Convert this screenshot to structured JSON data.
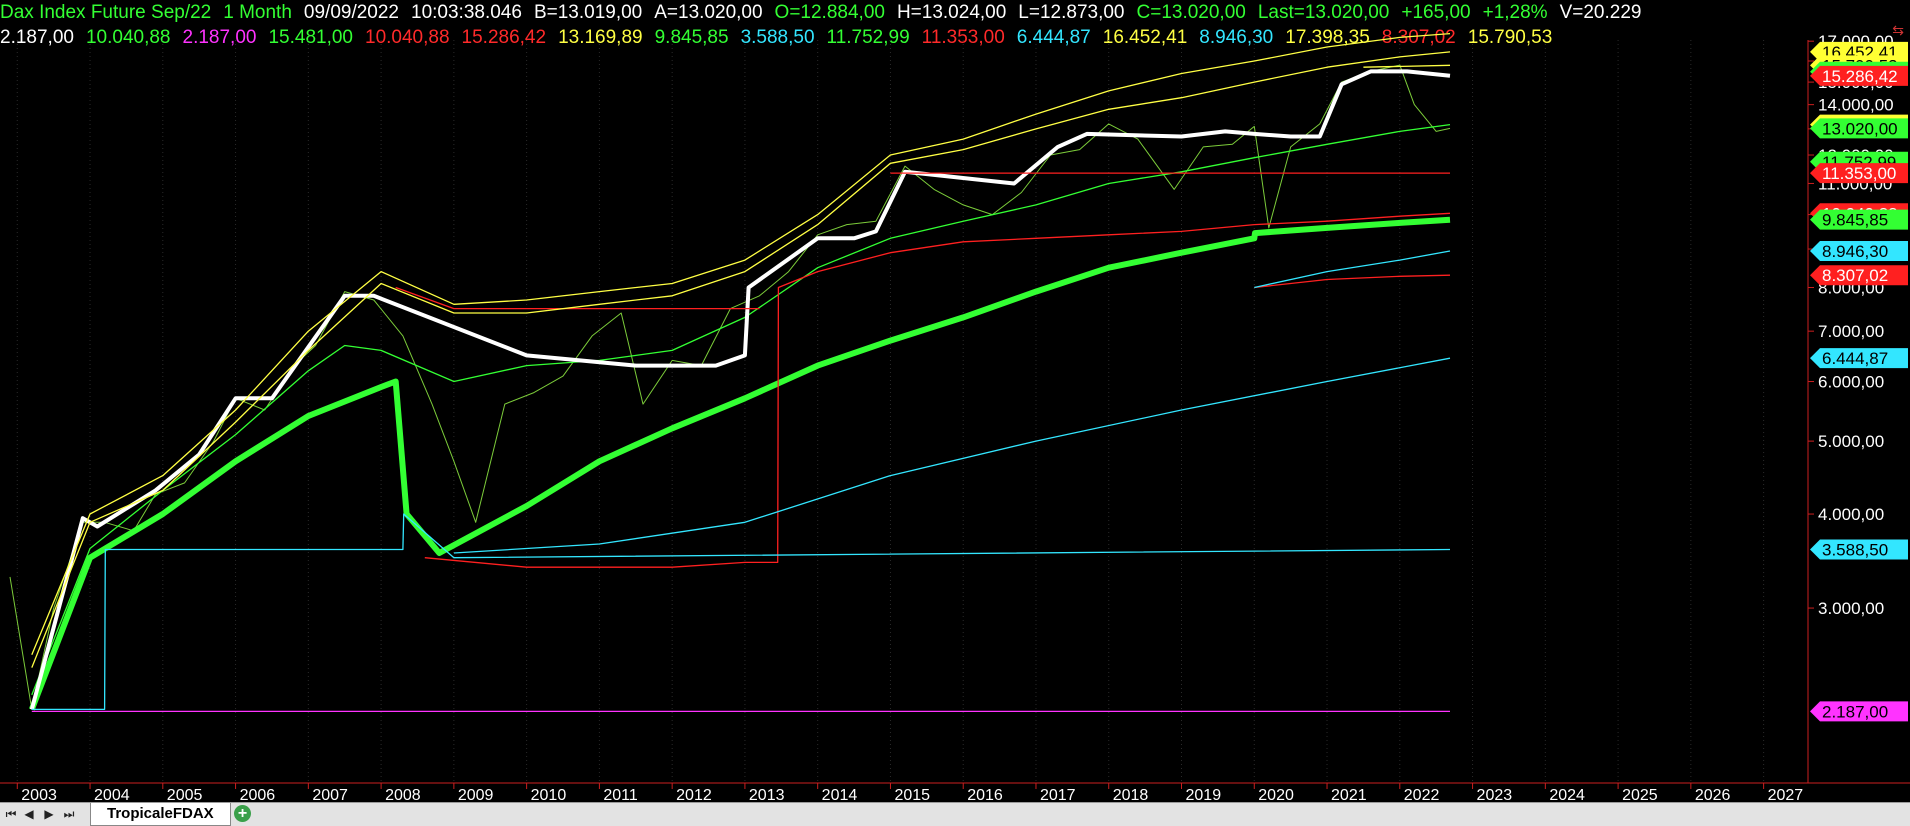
{
  "header": {
    "symbol": "Dax Index Future Sep/22",
    "period": "1 Month",
    "date": "09/09/2022",
    "time": "10:03:38.046",
    "bid": "B=13.019,00",
    "ask": "A=13.020,00",
    "open": "O=12.884,00",
    "high": "H=13.024,00",
    "low": "L=12.873,00",
    "close": "C=13.020,00",
    "last": "Last=13.020,00",
    "change": "+165,00",
    "change_pct": "+1,28%",
    "volume": "V=20.229"
  },
  "indicator_values": [
    {
      "text": "2.187,00",
      "color": "#ffffff"
    },
    {
      "text": "10.040,88",
      "color": "#33ff33"
    },
    {
      "text": "2.187,00",
      "color": "#ff33ff"
    },
    {
      "text": "15.481,00",
      "color": "#33ff33"
    },
    {
      "text": "10.040,88",
      "color": "#ff2a2a"
    },
    {
      "text": "15.286,42",
      "color": "#ff2a2a"
    },
    {
      "text": "13.169,89",
      "color": "#ffff44"
    },
    {
      "text": "9.845,85",
      "color": "#33ff33"
    },
    {
      "text": "3.588,50",
      "color": "#33e6ff"
    },
    {
      "text": "11.752,99",
      "color": "#33ff33"
    },
    {
      "text": "11.353,00",
      "color": "#ff2a2a"
    },
    {
      "text": "6.444,87",
      "color": "#33e6ff"
    },
    {
      "text": "16.452,41",
      "color": "#ffff44"
    },
    {
      "text": "8.946,30",
      "color": "#33e6ff"
    },
    {
      "text": "17.398,35",
      "color": "#ffff44"
    },
    {
      "text": "8.307,02",
      "color": "#ff2a2a"
    },
    {
      "text": "15.790,53",
      "color": "#ffff44"
    }
  ],
  "price_tags": [
    {
      "text": "16.452,41",
      "value": 16452,
      "bg": "#ffff33",
      "fg": "#000000"
    },
    {
      "text": "15.790,53",
      "value": 15790,
      "bg": "#ffff33",
      "fg": "#000000"
    },
    {
      "text": "15.481,00",
      "value": 15481,
      "bg": "#33ff33",
      "fg": "#000000"
    },
    {
      "text": "15.286,42",
      "value": 15286,
      "bg": "#ff2020",
      "fg": "#ffffff"
    },
    {
      "text": "13.169,89",
      "value": 13170,
      "bg": "#ffff33",
      "fg": "#000000"
    },
    {
      "text": "13.020,00",
      "value": 13020,
      "bg": "#33ff33",
      "fg": "#000000"
    },
    {
      "text": "11.752,99",
      "value": 11753,
      "bg": "#33ff33",
      "fg": "#000000"
    },
    {
      "text": "11.353,00",
      "value": 11353,
      "bg": "#ff2020",
      "fg": "#ffffff"
    },
    {
      "text": "10.040,88",
      "value": 10041,
      "bg": "#ff2020",
      "fg": "#ffffff"
    },
    {
      "text": "9.845,85",
      "value": 9846,
      "bg": "#33ff33",
      "fg": "#000000"
    },
    {
      "text": "8.946,30",
      "value": 8946,
      "bg": "#33e6ff",
      "fg": "#000000"
    },
    {
      "text": "8.307,02",
      "value": 8307,
      "bg": "#ff2020",
      "fg": "#ffffff"
    },
    {
      "text": "6.444,87",
      "value": 6445,
      "bg": "#33e6ff",
      "fg": "#000000"
    },
    {
      "text": "3.588,50",
      "value": 3589,
      "bg": "#33e6ff",
      "fg": "#000000"
    },
    {
      "text": "2.187,00",
      "value": 2187,
      "bg": "#ff33ff",
      "fg": "#000000"
    }
  ],
  "statusbar": {
    "sheet_tab": "TropicaleFDAX",
    "add_tab_icon": "plus-icon"
  },
  "chart_data": {
    "type": "line",
    "title": "Dax Index Future Sep/22",
    "xlabel": "",
    "ylabel": "",
    "x_tick_labels": [
      "2003",
      "2004",
      "2005",
      "2006",
      "2007",
      "2008",
      "2009",
      "2010",
      "2011",
      "2012",
      "2013",
      "2014",
      "2015",
      "2016",
      "2017",
      "2018",
      "2019",
      "2020",
      "2021",
      "2022",
      "2023",
      "2024",
      "2025",
      "2026",
      "2027"
    ],
    "y_tick_labels": [
      "17.000,00",
      "16.000,00",
      "15.000,00",
      "14.000,00",
      "13.000,00",
      "12.000,00",
      "11.000,00",
      "10.000,00",
      "9.000,00",
      "8.000,00",
      "7.000,00",
      "6.000,00",
      "5.000,00",
      "4.000,00",
      "3.000,00"
    ],
    "y_tick_values": [
      17000,
      16000,
      15000,
      14000,
      13000,
      12000,
      11000,
      10000,
      9000,
      8000,
      7000,
      6000,
      5000,
      4000,
      3000
    ],
    "xlim": [
      2002.9,
      2027.5
    ],
    "ylim": [
      1800,
      17700
    ],
    "log_scale": true,
    "grid": "vertical dotted",
    "series": [
      {
        "color": "#7ccc3a",
        "points": [
          [
            2002.9,
            3300
          ],
          [
            2003.2,
            2200
          ],
          [
            2003.5,
            3000
          ],
          [
            2003.9,
            3900
          ],
          [
            2004.2,
            3900
          ],
          [
            2004.6,
            3800
          ],
          [
            2004.9,
            4250
          ],
          [
            2005.3,
            4400
          ],
          [
            2005.7,
            5000
          ],
          [
            2006.0,
            5700
          ],
          [
            2006.4,
            5500
          ],
          [
            2006.8,
            6300
          ],
          [
            2007.1,
            6700
          ],
          [
            2007.5,
            7900
          ],
          [
            2007.9,
            7700
          ],
          [
            2008.3,
            6900
          ],
          [
            2008.7,
            5600
          ],
          [
            2009.0,
            4700
          ],
          [
            2009.3,
            3900
          ],
          [
            2009.7,
            5600
          ],
          [
            2010.1,
            5800
          ],
          [
            2010.5,
            6100
          ],
          [
            2010.9,
            6900
          ],
          [
            2011.3,
            7400
          ],
          [
            2011.6,
            5600
          ],
          [
            2012.0,
            6400
          ],
          [
            2012.4,
            6300
          ],
          [
            2012.8,
            7500
          ],
          [
            2013.2,
            7800
          ],
          [
            2013.6,
            8400
          ],
          [
            2014.0,
            9400
          ],
          [
            2014.4,
            9700
          ],
          [
            2014.8,
            9800
          ],
          [
            2015.2,
            11600
          ],
          [
            2015.6,
            10800
          ],
          [
            2016.0,
            10300
          ],
          [
            2016.4,
            10000
          ],
          [
            2016.8,
            10700
          ],
          [
            2017.2,
            12000
          ],
          [
            2017.6,
            12200
          ],
          [
            2018.0,
            13200
          ],
          [
            2018.4,
            12600
          ],
          [
            2018.9,
            10800
          ],
          [
            2019.3,
            12300
          ],
          [
            2019.7,
            12400
          ],
          [
            2020.0,
            13100
          ],
          [
            2020.2,
            9600
          ],
          [
            2020.5,
            12300
          ],
          [
            2020.9,
            13200
          ],
          [
            2021.2,
            15000
          ],
          [
            2021.6,
            15500
          ],
          [
            2022.0,
            15800
          ],
          [
            2022.2,
            14000
          ],
          [
            2022.5,
            12900
          ],
          [
            2022.69,
            13020
          ]
        ]
      },
      {
        "color": "#33ff33",
        "points": [
          [
            2003.2,
            2200
          ],
          [
            2004.0,
            3500
          ],
          [
            2005.0,
            4000
          ],
          [
            2006.0,
            4700
          ],
          [
            2007.0,
            5400
          ],
          [
            2008.0,
            5900
          ],
          [
            2008.2,
            6000
          ],
          [
            2008.35,
            4000
          ],
          [
            2008.8,
            3550
          ],
          [
            2010.0,
            4100
          ],
          [
            2011.0,
            4700
          ],
          [
            2012.0,
            5200
          ],
          [
            2013.0,
            5700
          ],
          [
            2014.0,
            6300
          ],
          [
            2015.0,
            6800
          ],
          [
            2016.0,
            7300
          ],
          [
            2017.0,
            7900
          ],
          [
            2018.0,
            8500
          ],
          [
            2019.0,
            8900
          ],
          [
            2020.0,
            9300
          ],
          [
            2020.01,
            9450
          ],
          [
            2021.0,
            9600
          ],
          [
            2022.0,
            9750
          ],
          [
            2022.69,
            9845
          ]
        ]
      },
      {
        "color": "#33ff33",
        "points": [
          [
            2003.2,
            2300
          ],
          [
            2004.0,
            3600
          ],
          [
            2005.0,
            4300
          ],
          [
            2006.0,
            5100
          ],
          [
            2007.0,
            6200
          ],
          [
            2007.5,
            6700
          ],
          [
            2008.0,
            6600
          ],
          [
            2009.0,
            6000
          ],
          [
            2010.0,
            6300
          ],
          [
            2011.0,
            6400
          ],
          [
            2012.0,
            6600
          ],
          [
            2013.0,
            7300
          ],
          [
            2014.0,
            8500
          ],
          [
            2015.0,
            9300
          ],
          [
            2016.0,
            9800
          ],
          [
            2017.0,
            10300
          ],
          [
            2018.0,
            11000
          ],
          [
            2019.0,
            11400
          ],
          [
            2020.0,
            11900
          ],
          [
            2021.0,
            12400
          ],
          [
            2022.0,
            12900
          ],
          [
            2022.69,
            13170
          ]
        ]
      },
      {
        "color": "#ffffff",
        "points": [
          [
            2003.2,
            2200
          ],
          [
            2003.9,
            3950
          ],
          [
            2004.1,
            3850
          ],
          [
            2004.9,
            4300
          ],
          [
            2005.5,
            4800
          ],
          [
            2006.0,
            5700
          ],
          [
            2006.5,
            5700
          ],
          [
            2007.5,
            7800
          ],
          [
            2007.9,
            7800
          ],
          [
            2010.0,
            6500
          ],
          [
            2011.5,
            6300
          ],
          [
            2012.6,
            6300
          ],
          [
            2013.0,
            6500
          ],
          [
            2013.05,
            8000
          ],
          [
            2014.0,
            9300
          ],
          [
            2014.5,
            9300
          ],
          [
            2014.8,
            9500
          ],
          [
            2015.2,
            11400
          ],
          [
            2016.7,
            11000
          ],
          [
            2017.3,
            12300
          ],
          [
            2017.7,
            12800
          ],
          [
            2019.0,
            12700
          ],
          [
            2019.6,
            12900
          ],
          [
            2020.0,
            12800
          ],
          [
            2020.5,
            12700
          ],
          [
            2020.9,
            12700
          ],
          [
            2021.2,
            14900
          ],
          [
            2021.6,
            15500
          ],
          [
            2022.1,
            15500
          ],
          [
            2022.69,
            15290
          ]
        ]
      },
      {
        "color": "#ff2020",
        "points": [
          [
            2008.2,
            8000
          ],
          [
            2009.0,
            7500
          ],
          [
            2010.0,
            7500
          ],
          [
            2011.0,
            7500
          ],
          [
            2012.0,
            7500
          ],
          [
            2013.0,
            7500
          ],
          [
            2013.2,
            7500
          ]
        ]
      },
      {
        "color": "#ff2020",
        "points": [
          [
            2008.6,
            3500
          ],
          [
            2010.0,
            3400
          ],
          [
            2011.0,
            3400
          ],
          [
            2012.0,
            3400
          ],
          [
            2013.0,
            3450
          ],
          [
            2013.45,
            3450
          ],
          [
            2013.46,
            8000
          ],
          [
            2014.0,
            8400
          ],
          [
            2015.0,
            8900
          ],
          [
            2016.0,
            9200
          ],
          [
            2017.0,
            9300
          ],
          [
            2018.0,
            9400
          ],
          [
            2019.0,
            9500
          ],
          [
            2020.0,
            9700
          ],
          [
            2021.0,
            9800
          ],
          [
            2022.0,
            9950
          ],
          [
            2022.69,
            10041
          ]
        ]
      },
      {
        "color": "#ff2020",
        "points": [
          [
            2015.0,
            11353
          ],
          [
            2022.69,
            11353
          ]
        ]
      },
      {
        "color": "#ff2020",
        "points": [
          [
            2020.0,
            8000
          ],
          [
            2021.0,
            8200
          ],
          [
            2022.0,
            8280
          ],
          [
            2022.69,
            8307
          ]
        ]
      },
      {
        "color": "#33e6ff",
        "points": [
          [
            2003.2,
            2200
          ],
          [
            2004.2,
            2200
          ],
          [
            2004.21,
            3589
          ],
          [
            2008.3,
            3589
          ],
          [
            2008.31,
            4000
          ],
          [
            2009.0,
            3500
          ],
          [
            2022.69,
            3589
          ]
        ]
      },
      {
        "color": "#33e6ff",
        "points": [
          [
            2009.0,
            3550
          ],
          [
            2011.0,
            3650
          ],
          [
            2013.0,
            3900
          ],
          [
            2015.0,
            4500
          ],
          [
            2017.0,
            5000
          ],
          [
            2019.0,
            5500
          ],
          [
            2021.0,
            6000
          ],
          [
            2022.69,
            6445
          ]
        ]
      },
      {
        "color": "#33e6ff",
        "points": [
          [
            2020.0,
            8000
          ],
          [
            2021.0,
            8400
          ],
          [
            2022.0,
            8700
          ],
          [
            2022.69,
            8946
          ]
        ]
      },
      {
        "color": "#ff33ff",
        "points": [
          [
            2003.2,
            2187
          ],
          [
            2022.69,
            2187
          ]
        ]
      },
      {
        "color": "#ffff44",
        "points": [
          [
            2003.2,
            2500
          ],
          [
            2004.0,
            3900
          ],
          [
            2005.0,
            4300
          ],
          [
            2006.0,
            5300
          ],
          [
            2007.0,
            6600
          ],
          [
            2008.0,
            8100
          ],
          [
            2009.0,
            7400
          ],
          [
            2010.0,
            7400
          ],
          [
            2011.0,
            7600
          ],
          [
            2012.0,
            7800
          ],
          [
            2013.0,
            8400
          ],
          [
            2014.0,
            9700
          ],
          [
            2015.0,
            11700
          ],
          [
            2016.0,
            12200
          ],
          [
            2017.0,
            13000
          ],
          [
            2018.0,
            13800
          ],
          [
            2019.0,
            14300
          ],
          [
            2020.0,
            15000
          ],
          [
            2021.0,
            15700
          ],
          [
            2022.0,
            16200
          ],
          [
            2022.69,
            16452
          ]
        ]
      },
      {
        "color": "#ffff44",
        "points": [
          [
            2003.2,
            2600
          ],
          [
            2004.0,
            4000
          ],
          [
            2005.0,
            4500
          ],
          [
            2006.0,
            5500
          ],
          [
            2007.0,
            7000
          ],
          [
            2008.0,
            8400
          ],
          [
            2009.0,
            7600
          ],
          [
            2010.0,
            7700
          ],
          [
            2011.0,
            7900
          ],
          [
            2012.0,
            8100
          ],
          [
            2013.0,
            8700
          ],
          [
            2014.0,
            10000
          ],
          [
            2015.0,
            12000
          ],
          [
            2016.0,
            12600
          ],
          [
            2017.0,
            13600
          ],
          [
            2018.0,
            14600
          ],
          [
            2019.0,
            15400
          ],
          [
            2020.0,
            16000
          ],
          [
            2021.0,
            16700
          ],
          [
            2022.0,
            17200
          ],
          [
            2022.69,
            17398
          ]
        ]
      },
      {
        "color": "#ffff44",
        "points": [
          [
            2021.5,
            15700
          ],
          [
            2022.69,
            15790
          ]
        ]
      }
    ]
  }
}
